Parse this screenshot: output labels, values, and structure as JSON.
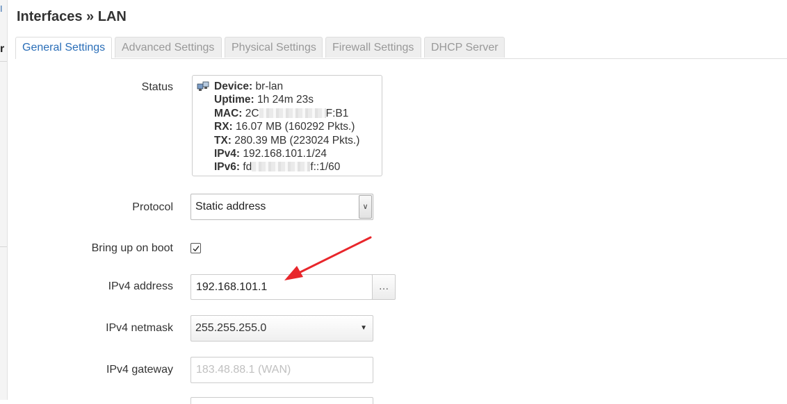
{
  "page": {
    "title": "Interfaces » LAN"
  },
  "tabs": [
    {
      "label": "General Settings",
      "active": true
    },
    {
      "label": "Advanced Settings",
      "active": false
    },
    {
      "label": "Physical Settings",
      "active": false
    },
    {
      "label": "Firewall Settings",
      "active": false
    },
    {
      "label": "DHCP Server",
      "active": false
    }
  ],
  "status": {
    "label": "Status",
    "icon": "network-ethernet-icon",
    "device_key": "Device:",
    "device_value": "br-lan",
    "uptime_key": "Uptime:",
    "uptime_value": "1h 24m 23s",
    "mac_key": "MAC:",
    "mac_prefix": "2C",
    "mac_suffix": "F:B1",
    "rx_key": "RX:",
    "rx_value": "16.07 MB (160292 Pkts.)",
    "tx_key": "TX:",
    "tx_value": "280.39 MB (223024 Pkts.)",
    "ipv4_key": "IPv4:",
    "ipv4_value": "192.168.101.1/24",
    "ipv6_key": "IPv6:",
    "ipv6_prefix": "fd",
    "ipv6_suffix": "f::1/60"
  },
  "protocol": {
    "label": "Protocol",
    "value": "Static address"
  },
  "boot": {
    "label": "Bring up on boot",
    "checked": true
  },
  "ipv4_address": {
    "label": "IPv4 address",
    "value": "192.168.101.1",
    "button": "…"
  },
  "ipv4_netmask": {
    "label": "IPv4 netmask",
    "value": "255.255.255.0"
  },
  "ipv4_gateway": {
    "label": "IPv4 gateway",
    "placeholder": "183.48.88.1 (WAN)"
  },
  "colors": {
    "accent": "#2a6eb8",
    "annotation": "#e8262b",
    "border": "#cccccc"
  }
}
